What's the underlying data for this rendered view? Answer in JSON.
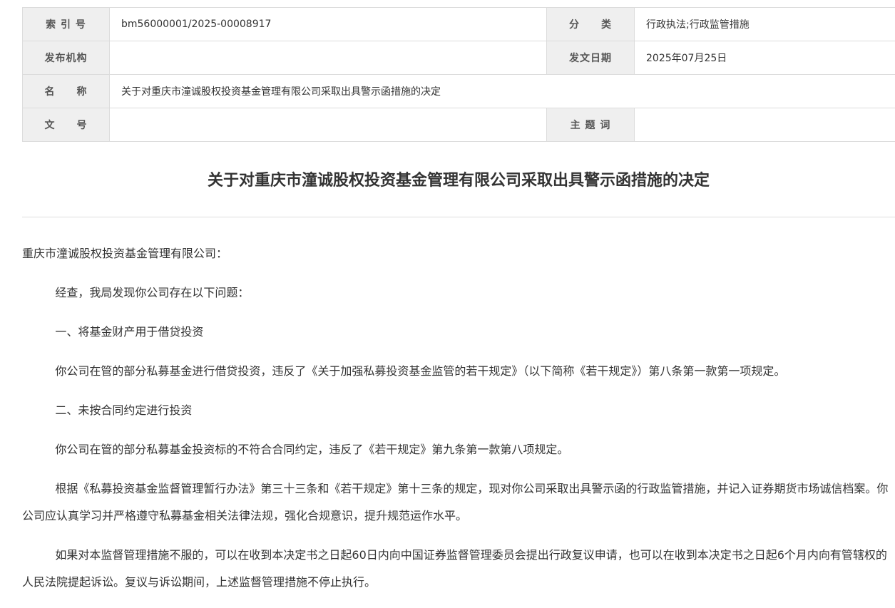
{
  "meta": {
    "index_label": "索 引 号",
    "index_value": "bm56000001/2025-00008917",
    "category_label": "分　　类",
    "category_value": "行政执法;行政监管措施",
    "issuer_label": "发布机构",
    "issuer_value": "",
    "date_label": "发文日期",
    "date_value": "2025年07月25日",
    "name_label": "名　　称",
    "name_value": "关于对重庆市潼诚股权投资基金管理有限公司采取出具警示函措施的决定",
    "docnum_label": "文　　号",
    "docnum_value": "",
    "keywords_label": "主 题 词",
    "keywords_value": ""
  },
  "document": {
    "title": "关于对重庆市潼诚股权投资基金管理有限公司采取出具警示函措施的决定",
    "paragraphs": [
      "重庆市潼诚股权投资基金管理有限公司：",
      "经查，我局发现你公司存在以下问题：",
      "一、将基金财产用于借贷投资",
      "你公司在管的部分私募基金进行借贷投资，违反了《关于加强私募投资基金监管的若干规定》（以下简称《若干规定》）第八条第一款第一项规定。",
      "二、未按合同约定进行投资",
      "你公司在管的部分私募基金投资标的不符合合同约定，违反了《若干规定》第九条第一款第八项规定。",
      "根据《私募投资基金监督管理暂行办法》第三十三条和《若干规定》第十三条的规定，现对你公司采取出具警示函的行政监管措施，并记入证券期货市场诚信档案。你公司应认真学习并严格遵守私募基金相关法律法规，强化合规意识，提升规范运作水平。",
      "如果对本监督管理措施不服的，可以在收到本决定书之日起60日内向中国证券监督管理委员会提出行政复议申请，也可以在收到本决定书之日起6个月内向有管辖权的人民法院提起诉讼。复议与诉讼期间，上述监督管理措施不停止执行。"
    ]
  }
}
